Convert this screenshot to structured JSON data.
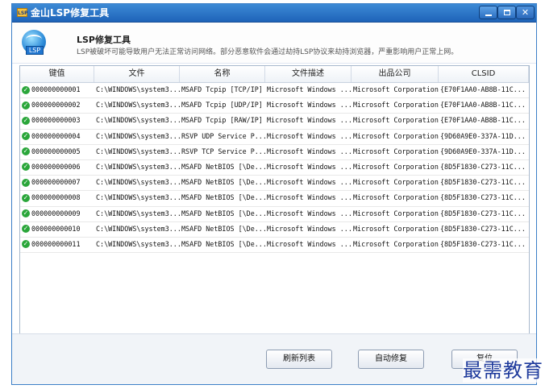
{
  "window": {
    "title": "金山LSP修复工具",
    "icon": "lsp-app-icon",
    "icon_text": "LSP",
    "controls": {
      "minimize": "minimize-icon",
      "maximize": "maximize-icon",
      "close": "close-icon",
      "close_glyph": "✕"
    }
  },
  "header": {
    "icon": "globe-lsp-icon",
    "icon_badge": "LSP",
    "title": "LSP修复工具",
    "description": "LSP被破坏可能导致用户无法正常访问网络。部分恶意软件会通过劫持LSP协议来劫持浏览器，严重影响用户正常上网。"
  },
  "table": {
    "columns": [
      "键值",
      "文件",
      "名称",
      "文件描述",
      "出品公司",
      "CLSID"
    ],
    "status_icon": "check-circle-icon",
    "status_glyph": "✓",
    "rows": [
      [
        "000000000001",
        "C:\\WINDOWS\\system3...",
        "MSAFD Tcpip [TCP/IP]",
        "Microsoft Windows ...",
        "Microsoft Corporation",
        "{E70F1AA0-AB8B-11C..."
      ],
      [
        "000000000002",
        "C:\\WINDOWS\\system3...",
        "MSAFD Tcpip [UDP/IP]",
        "Microsoft Windows ...",
        "Microsoft Corporation",
        "{E70F1AA0-AB8B-11C..."
      ],
      [
        "000000000003",
        "C:\\WINDOWS\\system3...",
        "MSAFD Tcpip [RAW/IP]",
        "Microsoft Windows ...",
        "Microsoft Corporation",
        "{E70F1AA0-AB8B-11C..."
      ],
      [
        "000000000004",
        "C:\\WINDOWS\\system3...",
        "RSVP UDP Service P...",
        "Microsoft Windows ...",
        "Microsoft Corporation",
        "{9D60A9E0-337A-11D..."
      ],
      [
        "000000000005",
        "C:\\WINDOWS\\system3...",
        "RSVP TCP Service P...",
        "Microsoft Windows ...",
        "Microsoft Corporation",
        "{9D60A9E0-337A-11D..."
      ],
      [
        "000000000006",
        "C:\\WINDOWS\\system3...",
        "MSAFD NetBIOS [\\De...",
        "Microsoft Windows ...",
        "Microsoft Corporation",
        "{8D5F1830-C273-11C..."
      ],
      [
        "000000000007",
        "C:\\WINDOWS\\system3...",
        "MSAFD NetBIOS [\\De...",
        "Microsoft Windows ...",
        "Microsoft Corporation",
        "{8D5F1830-C273-11C..."
      ],
      [
        "000000000008",
        "C:\\WINDOWS\\system3...",
        "MSAFD NetBIOS [\\De...",
        "Microsoft Windows ...",
        "Microsoft Corporation",
        "{8D5F1830-C273-11C..."
      ],
      [
        "000000000009",
        "C:\\WINDOWS\\system3...",
        "MSAFD NetBIOS [\\De...",
        "Microsoft Windows ...",
        "Microsoft Corporation",
        "{8D5F1830-C273-11C..."
      ],
      [
        "000000000010",
        "C:\\WINDOWS\\system3...",
        "MSAFD NetBIOS [\\De...",
        "Microsoft Windows ...",
        "Microsoft Corporation",
        "{8D5F1830-C273-11C..."
      ],
      [
        "000000000011",
        "C:\\WINDOWS\\system3...",
        "MSAFD NetBIOS [\\De...",
        "Microsoft Windows ...",
        "Microsoft Corporation",
        "{8D5F1830-C273-11C..."
      ]
    ]
  },
  "buttons": {
    "refresh": "刷新列表",
    "auto_fix": "自动修复",
    "restore": "复位"
  },
  "watermark": "最需教育",
  "colors": {
    "title_bar": "#2a72c9",
    "accent": "#1e63b8",
    "status_ok": "#2aa63a",
    "watermark": "#1e3a9c"
  }
}
